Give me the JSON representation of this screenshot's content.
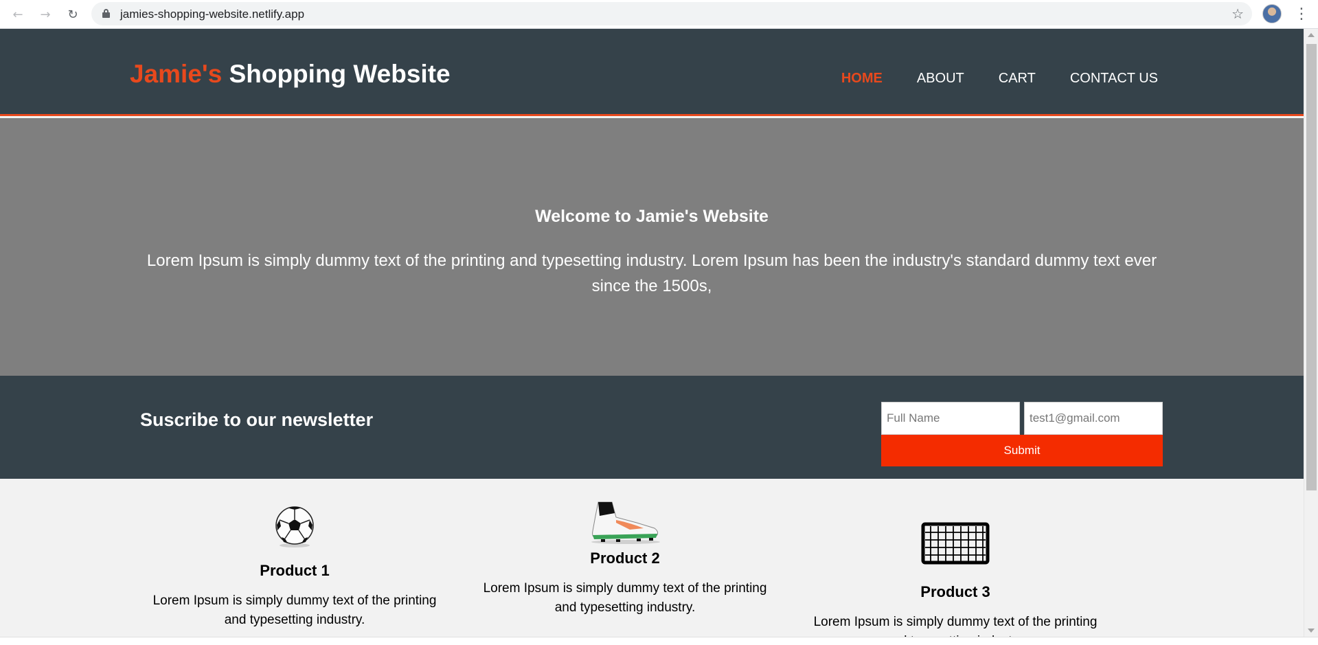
{
  "browser": {
    "url": "jamies-shopping-website.netlify.app"
  },
  "header": {
    "logo_highlight": "Jamie's",
    "logo_rest": "Shopping Website",
    "nav": [
      {
        "label": "HOME",
        "current": true
      },
      {
        "label": "ABOUT",
        "current": false
      },
      {
        "label": "CART",
        "current": false
      },
      {
        "label": "CONTACT US",
        "current": false
      }
    ]
  },
  "showcase": {
    "heading": "Welcome to Jamie's Website",
    "text": "Lorem Ipsum is simply dummy text of the printing and typesetting industry. Lorem Ipsum has been the industry's standard dummy text ever since the 1500s,"
  },
  "newsletter": {
    "heading": "Suscribe to our newsletter",
    "name_placeholder": "Full Name",
    "email_placeholder": "test1@gmail.com",
    "submit_label": "Submit"
  },
  "products": [
    {
      "title": "Product 1",
      "text": "Lorem Ipsum is simply dummy text of the printing and typesetting industry.",
      "icon": "soccer-ball-icon"
    },
    {
      "title": "Product 2",
      "text": "Lorem Ipsum is simply dummy text of the printing and typesetting industry.",
      "icon": "soccer-cleat-icon"
    },
    {
      "title": "Product 3",
      "text": "Lorem Ipsum is simply dummy text of the printing and typesetting industry.",
      "icon": "soccer-goal-icon"
    }
  ],
  "colors": {
    "header_bg": "#35424a",
    "accent": "#e8491d",
    "showcase_bg": "#7f7f7f",
    "submit_bg": "#f42c00",
    "body_bg": "#f2f2f2"
  }
}
